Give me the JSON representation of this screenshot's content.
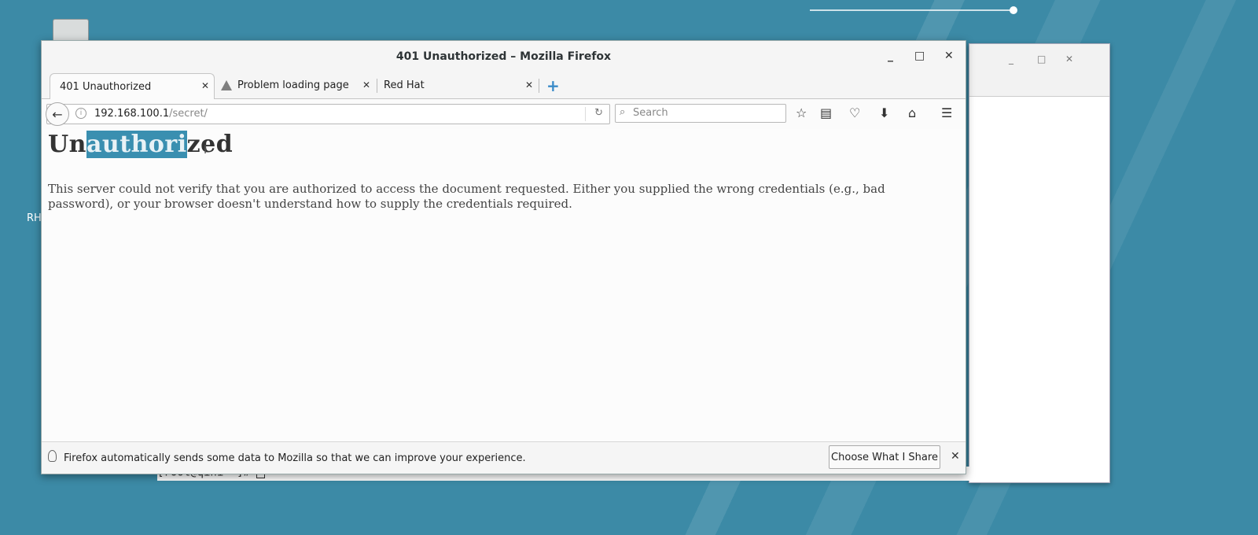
{
  "desktop": {
    "label": "RH"
  },
  "terminal": {
    "prompt": "[root@qini ~]# "
  },
  "back_window": {
    "minimize": "_",
    "maximize": "□",
    "close": "✕"
  },
  "window": {
    "title": "401 Unauthorized – Mozilla Firefox",
    "minimize": "_",
    "maximize": "□",
    "close": "✕"
  },
  "tabs": [
    {
      "label": "401 Unauthorized",
      "close": "✕",
      "active": true
    },
    {
      "label": "Problem loading page",
      "close": "✕",
      "active": false,
      "icon": "warning-icon"
    },
    {
      "label": "Red Hat",
      "close": "✕",
      "active": false
    }
  ],
  "new_tab": "+",
  "navbar": {
    "back": "←",
    "url_host": "192.168.100.1",
    "url_path": "/secret/",
    "reload": "↻",
    "search_placeholder": "Search",
    "icons": [
      "star-icon",
      "reading-list-icon",
      "pocket-icon",
      "download-icon",
      "home-icon",
      "menu-icon"
    ]
  },
  "page": {
    "heading_pre": "Un",
    "heading_selected": "authori",
    "heading_post": "zed",
    "body": "This server could not verify that you are authorized to access the document requested. Either you supplied the wrong credentials (e.g., bad password), or your browser doesn't understand how to supply the credentials required."
  },
  "notification": {
    "text": "Firefox automatically sends some data to Mozilla so that we can improve your experience.",
    "button": "Choose What I Share",
    "close": "✕"
  }
}
